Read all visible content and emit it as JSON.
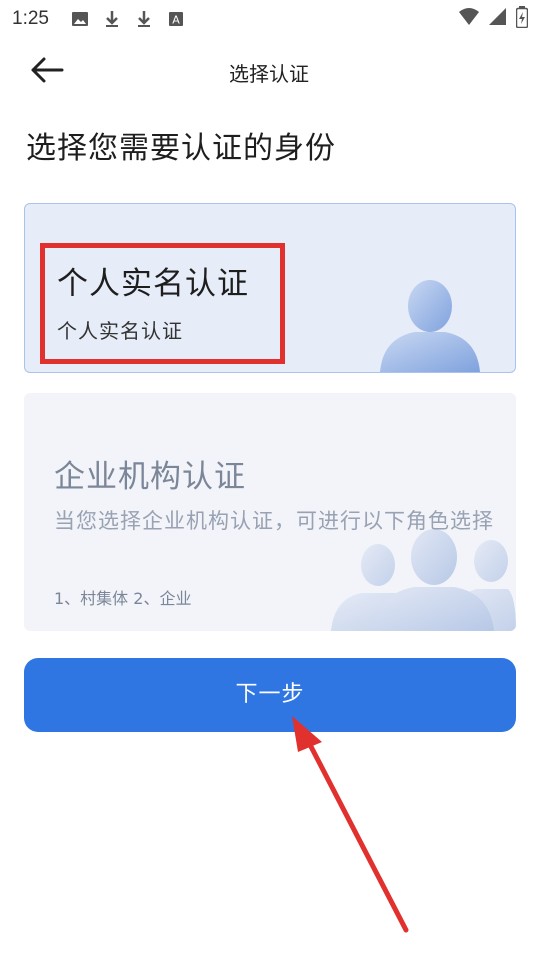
{
  "status_bar": {
    "time": "1:25",
    "left_icons": [
      "image-icon",
      "download-icon",
      "download-icon",
      "font-icon"
    ],
    "right_icons": [
      "wifi-icon",
      "signal-icon",
      "battery-icon"
    ]
  },
  "nav": {
    "title": "选择认证",
    "back_icon": "arrow-left-icon"
  },
  "page": {
    "title": "选择您需要认证的身份"
  },
  "cards": {
    "personal": {
      "title": "个人实名认证",
      "subtitle": "个人实名认证",
      "icon": "person-icon",
      "selected": true
    },
    "enterprise": {
      "title": "企业机构认证",
      "description": "当您选择企业机构认证，可进行以下角色选择",
      "roles": "1、村集体   2、企业",
      "icon": "group-icon",
      "selected": false
    }
  },
  "actions": {
    "next_label": "下一步"
  },
  "colors": {
    "primary": "#2f76e3",
    "highlight": "#e0312f",
    "selected_card_bg": "#e6ecf8",
    "card_bg": "#f2f4f9"
  }
}
